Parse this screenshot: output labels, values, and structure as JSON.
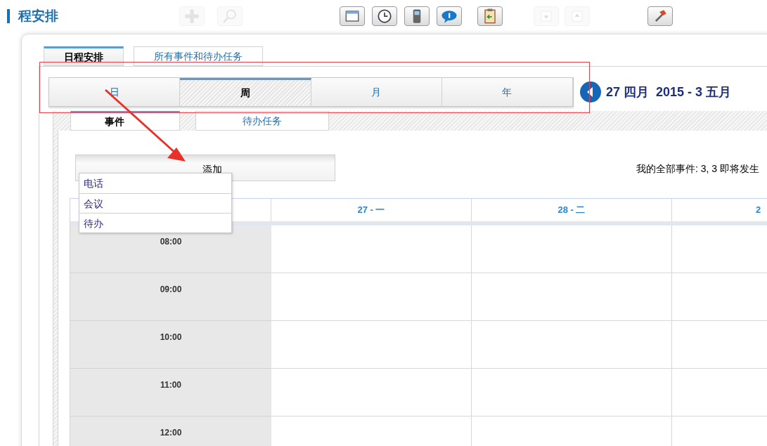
{
  "app_title": "程安排",
  "toolbar": [
    {
      "kind": "plus",
      "disabled": true
    },
    {
      "kind": "search",
      "disabled": true
    },
    {
      "kind": "window",
      "disabled": false
    },
    {
      "kind": "clock",
      "disabled": false
    },
    {
      "kind": "phone",
      "disabled": false
    },
    {
      "kind": "chat",
      "disabled": false
    },
    {
      "kind": "clipboard",
      "disabled": false
    },
    {
      "kind": "down",
      "disabled": true
    },
    {
      "kind": "up",
      "disabled": true
    },
    {
      "kind": "hammer",
      "disabled": false
    }
  ],
  "main_tabs": [
    {
      "label": "日程安排",
      "selected": true
    },
    {
      "label": "所有事件和待办任务",
      "selected": false
    }
  ],
  "view_tabs": [
    {
      "label": "日",
      "selected": false
    },
    {
      "label": "周",
      "selected": true
    },
    {
      "label": "月",
      "selected": false
    },
    {
      "label": "年",
      "selected": false
    }
  ],
  "date_range": "27 四月  2015 - 3 五月",
  "sub_tabs": [
    {
      "label": "事件",
      "selected": true
    },
    {
      "label": "待办任务",
      "selected": false
    }
  ],
  "add_button": "添加",
  "add_menu": [
    "电话",
    "会议",
    "待办"
  ],
  "summary": "我的全部事件: 3, 3 即将发生",
  "calendar": {
    "columns": [
      "27 - 一",
      "28 - 二",
      "2"
    ],
    "times": [
      "08:00",
      "09:00",
      "10:00",
      "11:00",
      "12:00"
    ]
  }
}
